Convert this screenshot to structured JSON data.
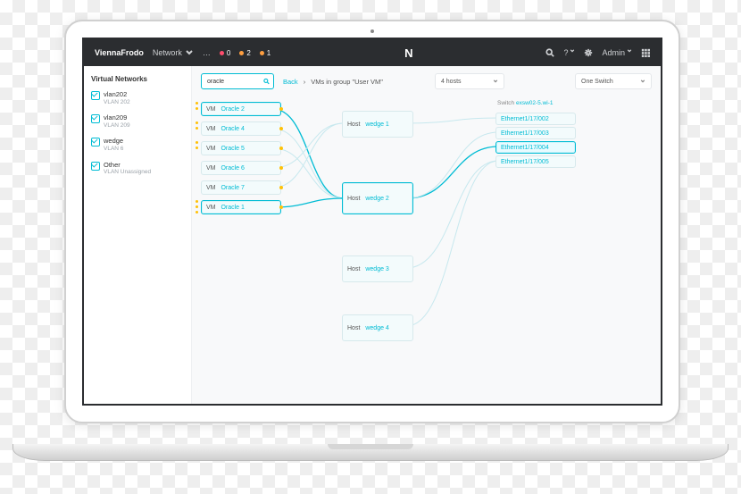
{
  "nav": {
    "brand": "ViennaFrodo",
    "network": "Network",
    "badges": [
      {
        "count": "0",
        "color": "#ff4d6d"
      },
      {
        "count": "2",
        "color": "#ff9f40"
      },
      {
        "count": "1",
        "color": "#ff9f40"
      }
    ],
    "admin": "Admin"
  },
  "sidebar": {
    "title": "Virtual Networks",
    "items": [
      {
        "name": "vlan202",
        "sub": "VLAN 202",
        "checked": true
      },
      {
        "name": "vlan209",
        "sub": "VLAN 209",
        "checked": true
      },
      {
        "name": "wedge",
        "sub": "VLAN 6",
        "checked": true
      },
      {
        "name": "Other",
        "sub": "VLAN Unassigned",
        "checked": true
      }
    ]
  },
  "toolbar": {
    "search": "oracle",
    "back": "Back",
    "crumb": "VMs in group \"User VM\"",
    "hosts": "4 hosts",
    "switch": "One Switch"
  },
  "switch_label": {
    "pre": "Switch",
    "link": "exsw02-5.wi-1"
  },
  "vms": [
    {
      "pre": "VM",
      "name": "Oracle 2",
      "sel": true,
      "dot": true
    },
    {
      "pre": "VM",
      "name": "Oracle 4",
      "dot": true
    },
    {
      "pre": "VM",
      "name": "Oracle 5",
      "dot": true
    },
    {
      "pre": "VM",
      "name": "Oracle 6",
      "dot": true
    },
    {
      "pre": "VM",
      "name": "Oracle 7",
      "dot": true
    },
    {
      "pre": "VM",
      "name": "Oracle 1",
      "sel": true,
      "dot": true
    }
  ],
  "hosts": [
    {
      "pre": "Host",
      "name": "wedge 1"
    },
    {
      "pre": "Host",
      "name": "wedge 2",
      "tall": true,
      "sel": true
    },
    {
      "pre": "Host",
      "name": "wedge 3"
    },
    {
      "pre": "Host",
      "name": "wedge 4"
    }
  ],
  "ports": [
    {
      "name": "Ethernet1/17/002"
    },
    {
      "name": "Ethernet1/17/003"
    },
    {
      "name": "Ethernet1/17/004",
      "sel": true
    },
    {
      "name": "Ethernet1/17/005"
    }
  ]
}
